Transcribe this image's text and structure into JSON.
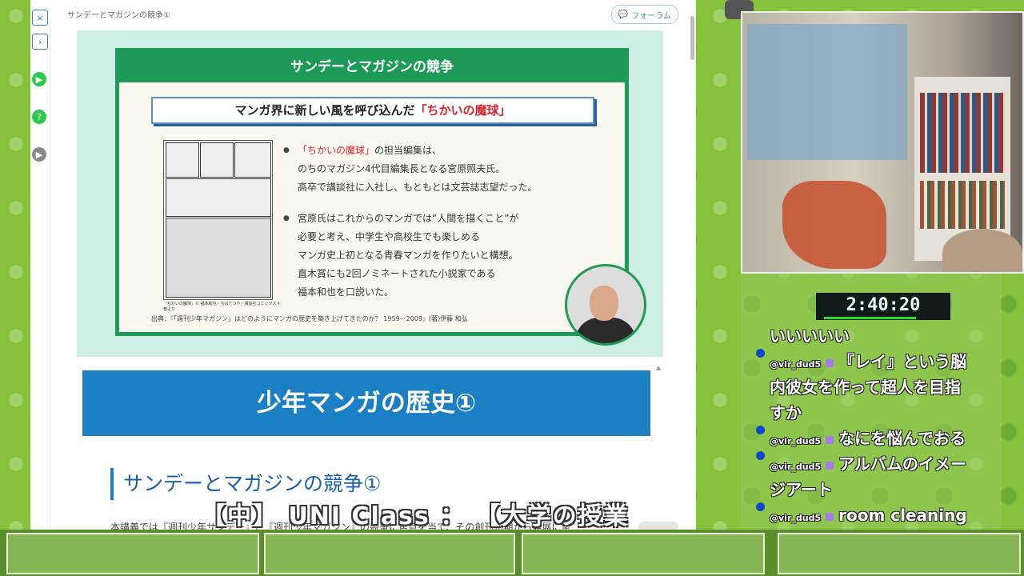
{
  "browser": {
    "breadcrumb": "サンデーとマガジンの競争①",
    "form_button": "フォーラム"
  },
  "slide": {
    "title": "サンデーとマガジンの競争",
    "subtitle_prefix": "マンガ界に新しい風を呼び込んだ",
    "subtitle_highlight": "「ちかいの魔球」",
    "bullet1_highlight": "「ちかいの魔球」",
    "bullet1_rest": "の担当編集は、",
    "bullet1_lines": [
      "のちのマガジン4代目編集長となる宮原照夫氏。",
      "高卒で講談社に入社し、もともとは文芸誌志望だった。"
    ],
    "bullet2_lines": [
      "宮原氏はこれからのマンガでは“人間を描くこと”が",
      "必要と考え、中学生や高校生でも楽しめる",
      "マンガ史上初となる青春マンガを作りたいと構想。",
      "直木賞にも2回ノミネートされた小説家である",
      "福本和也を口説いた。"
    ],
    "manga_caption": "『ちかいの魔球』© 福本和也・ちばてつや／講談社コミックス４巻より",
    "source": "出典：『「週刊少年マガジン」はどのようにマンガの歴史を築き上げてきたのか？ 1959－2009』(著)伊藤 和弘"
  },
  "page": {
    "heading": "少年マンガの歴史①",
    "section_heading": "サンデーとマガジンの競争①",
    "body_text": "本講義では『週刊少年サンデー』と『週刊少年マガジン』の競争に焦点を当て、その創刊初期から発展に至"
  },
  "overlay": {
    "title": "【中】 UNI Class ： 【大学の授業"
  },
  "timer": "2:40:20",
  "chat": {
    "messages": [
      {
        "user": "",
        "text": "いいいいい"
      },
      {
        "user": "@vir_dud5",
        "text": "『レイ』という脳"
      },
      {
        "user": "",
        "text": "内彼女を作って超人を目指"
      },
      {
        "user": "",
        "text": "すか"
      },
      {
        "user": "@vir_dud5",
        "text": "なにを悩んでおる"
      },
      {
        "user": "@vir_dud5",
        "text": "アルバムのイメー"
      },
      {
        "user": "",
        "text": "ジアート"
      },
      {
        "user": "@vir_dud5",
        "text": "room cleaning"
      }
    ]
  },
  "colors": {
    "slide_green": "#1e9a57",
    "heading_blue": "#1b7fc4",
    "highlight_red": "#d9262e",
    "timer_green": "#2ddc2d"
  }
}
